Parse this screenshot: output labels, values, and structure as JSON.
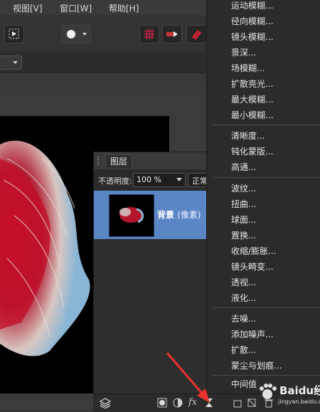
{
  "menubar": {
    "items": [
      {
        "label": "视图[V]"
      },
      {
        "label": "窗口[W]"
      },
      {
        "label": "帮助[H]"
      }
    ]
  },
  "layers_panel": {
    "tab_label": "图层",
    "opacity_label": "不透明度:",
    "opacity_value": "100 %",
    "blend_value": "正常",
    "layer": {
      "name": "背景",
      "type": "(像素)"
    }
  },
  "filter_menu": {
    "blur_group": [
      "运动模糊...",
      "径向模糊...",
      "镜头模糊...",
      "景深...",
      "场模糊...",
      "扩散亮光...",
      "最大模糊...",
      "最小模糊..."
    ],
    "sharpen_group": [
      "清晰度...",
      "钝化蒙版...",
      "高通..."
    ],
    "distort_group": [
      "波纹...",
      "扭曲...",
      "球面...",
      "置换...",
      "收缩/膨胀...",
      "镜头畸变...",
      "透视...",
      "液化..."
    ],
    "noise_group": [
      "去噪...",
      "添加噪声...",
      "扩散...",
      "蒙尘与划痕..."
    ],
    "partial_item": "中间值"
  },
  "bottombar": {
    "fx_label": "fx"
  },
  "watermark": {
    "text": "Baidu经验",
    "url": "jingyan.baidu.com"
  },
  "colors": {
    "accent_selection": "#5b86c6",
    "arrow": "#e8312f",
    "menu_bg": "#2b2b2b"
  }
}
